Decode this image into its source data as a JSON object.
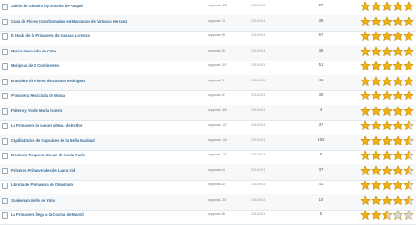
{
  "rows": [
    {
      "title": "Jabón de Gelatina by Bonnija de Raquel",
      "id": "wp-post-163",
      "date": "2014/02/3",
      "count": "27",
      "rating": 5
    },
    {
      "title": "Capa de Flores transformadas en Manzanos de Virtuosa Herranz",
      "id": "wp-post-74",
      "date": "2014/02/3",
      "count": "39",
      "rating": 5
    },
    {
      "title": "El Hada de la Primavera de Susana Lorenzo",
      "id": "wp-post-99",
      "date": "2014/02/3",
      "count": "67",
      "rating": 5
    },
    {
      "title": "Marco Decorado de Ceba",
      "id": "wp-post-35",
      "date": "2014/02/3",
      "count": "35",
      "rating": 5
    },
    {
      "title": "Mariposa de 3 Continentes",
      "id": "wp-post-157",
      "date": "2014/02/3",
      "count": "51",
      "rating": 5
    },
    {
      "title": "Bracalete de Flores de Susana Rodríguez",
      "id": "wp-post-71",
      "date": "2014/02/3",
      "count": "41",
      "rating": 5
    },
    {
      "title": "Primavera Reciclada de Miosa",
      "id": "wp-post-92",
      "date": "2014/02/3",
      "count": "35",
      "rating": 5
    },
    {
      "title": "Plátero y Yo de María Cuesta",
      "id": "wp-post-160",
      "date": "2014/02/3",
      "count": "4",
      "rating": 5
    },
    {
      "title": "La Primavera la sangre altera, de Esther",
      "id": "wp-post-147",
      "date": "2014/02/3",
      "count": "37",
      "rating": 4.5
    },
    {
      "title": "Capilla Dulce de Cupcakes de la Bella Navidad",
      "id": "wp-post-134",
      "date": "2014/02/3",
      "count": "192",
      "rating": 4.5
    },
    {
      "title": "Bisutería Turquesa Ocean de Anela Fable",
      "id": "wp-post-121",
      "date": "2014/02/3",
      "count": "6",
      "rating": 4.5
    },
    {
      "title": "Pulseras Primaverales de Laura Cid",
      "id": "wp-post-64",
      "date": "2014/02/3",
      "count": "37",
      "rating": 4.5
    },
    {
      "title": "Librota de Primavera de Oleashion",
      "id": "wp-post-30",
      "date": "2014/02/3",
      "count": "41",
      "rating": 4.5
    },
    {
      "title": "Shakeman Belly de Yoko",
      "id": "wp-post-157",
      "date": "2014/02/3",
      "count": "10",
      "rating": 4.5
    },
    {
      "title": "La Primavera llega a la Cocina de Manoli",
      "id": "wp-post-38",
      "date": "2014/02/3",
      "count": "5",
      "rating": 2.5
    }
  ],
  "colors": {
    "star_fill": "#f0b114",
    "star_empty": "#d6d6d6",
    "link": "#3c6e96"
  }
}
